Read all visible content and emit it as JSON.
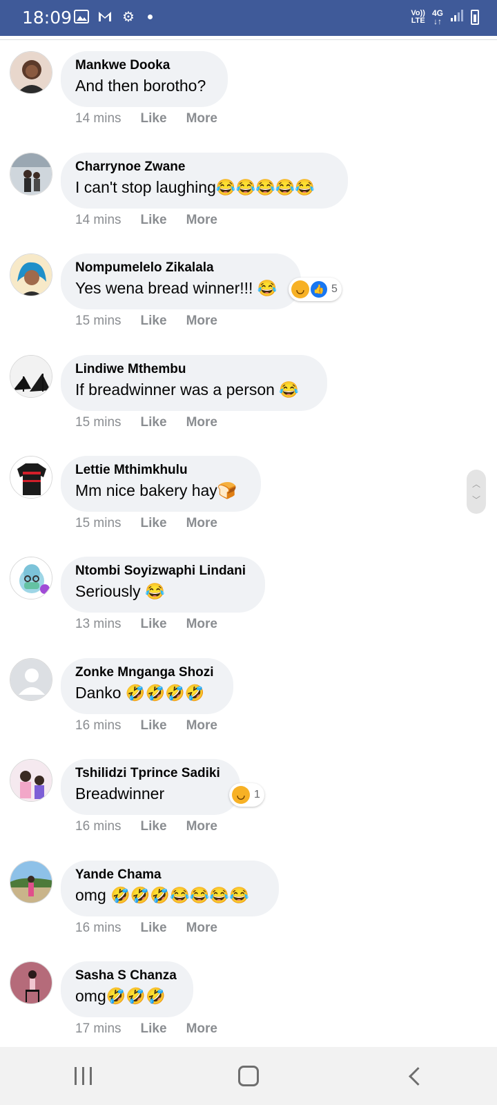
{
  "status_bar": {
    "time": "18:09",
    "left_icons": [
      "gallery-icon",
      "gmail-icon",
      "settings-gear-icon",
      "notification-dot-icon"
    ],
    "volte_label": "Vo)) LTE",
    "network_label": "4G",
    "background_color": "#3f5a99"
  },
  "comments": [
    {
      "author": "Mankwe Dooka",
      "text": "And then borotho?",
      "time": "14 mins",
      "like": "Like",
      "more": "More"
    },
    {
      "author": "Charrynoe Zwane",
      "text": "I can't stop laughing😂😂😂😂😂",
      "time": "14 mins",
      "like": "Like",
      "more": "More"
    },
    {
      "author": "Nompumelelo Zikalala",
      "text": "Yes wena bread winner!!! 😂",
      "time": "15 mins",
      "like": "Like",
      "more": "More",
      "reaction_count": "5",
      "reactions": [
        "haha",
        "like"
      ]
    },
    {
      "author": "Lindiwe Mthembu",
      "text": "If breadwinner was a person 😂",
      "time": "15 mins",
      "like": "Like",
      "more": "More"
    },
    {
      "author": "Lettie Mthimkhulu",
      "text": "Mm nice bakery hay🍞",
      "time": "15 mins",
      "like": "Like",
      "more": "More"
    },
    {
      "author": "Ntombi Soyizwaphi Lindani",
      "text": "Seriously 😂",
      "time": "13 mins",
      "like": "Like",
      "more": "More"
    },
    {
      "author": "Zonke Mnganga Shozi",
      "text": "Danko 🤣🤣🤣🤣",
      "time": "16 mins",
      "like": "Like",
      "more": "More"
    },
    {
      "author": "Tshilidzi Tprince Sadiki",
      "text": "Breadwinner",
      "time": "16 mins",
      "like": "Like",
      "more": "More",
      "reaction_count": "1",
      "reactions": [
        "haha"
      ]
    },
    {
      "author": "Yande Chama",
      "text": "omg 🤣🤣🤣😂😂😂😂",
      "time": "16 mins",
      "like": "Like",
      "more": "More"
    },
    {
      "author": "Sasha S Chanza",
      "text": "omg🤣🤣🤣",
      "time": "17 mins",
      "like": "Like",
      "more": "More"
    }
  ],
  "colors": {
    "bubble": "#f0f2f5",
    "meta_text": "#8a8d91",
    "like_blue": "#1877f2",
    "haha_yellow": "#f7b125"
  },
  "nav_bar": {
    "buttons": [
      "recent-apps-icon",
      "home-icon",
      "back-icon"
    ]
  }
}
